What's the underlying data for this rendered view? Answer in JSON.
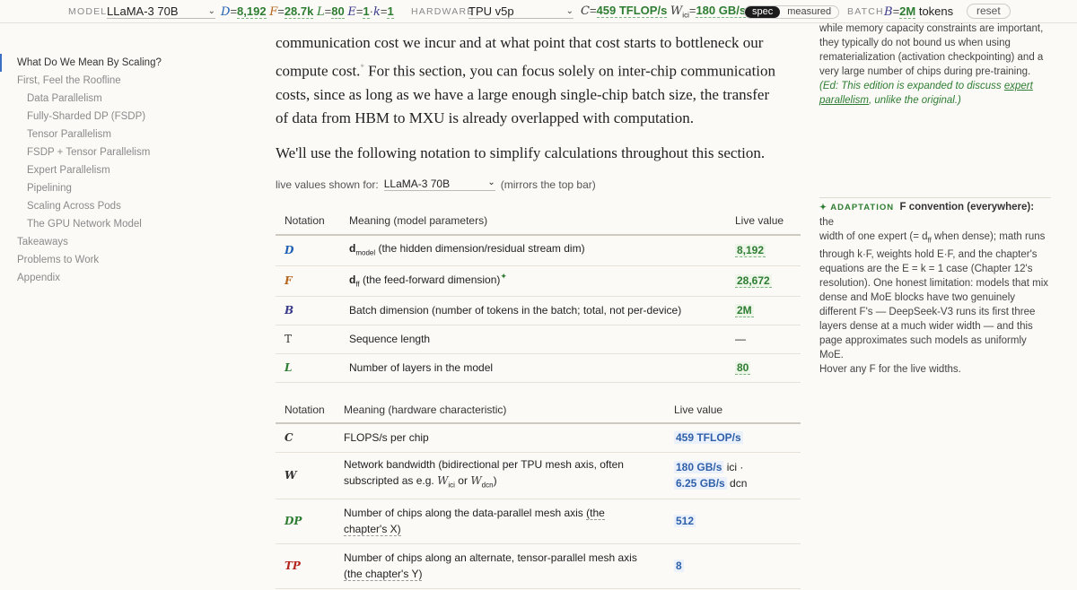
{
  "topbar": {
    "model_label": "MODEL",
    "model_value": "LLaMA-3 70B",
    "params": [
      {
        "sym": "D",
        "val": "8,192"
      },
      {
        "sym": "F",
        "val": "28.7k"
      },
      {
        "sym": "L",
        "val": "80"
      },
      {
        "sym": "E",
        "val": "1"
      },
      {
        "sym": "k",
        "val": "1"
      }
    ],
    "hardware_label": "HARDWARE",
    "hardware_value": "TPU v5p",
    "hw_c_sym": "C",
    "hw_c_val": "459 TFLOP/s",
    "hw_w_sym": "W",
    "hw_w_sub": "ici",
    "hw_w_val": "180 GB/s",
    "toggle_spec": "spec",
    "toggle_measured": "measured",
    "batch_label": "BATCH",
    "batch_sym": "B",
    "batch_val": "2M",
    "batch_unit": "tokens",
    "reset_label": "reset"
  },
  "sidebar": {
    "items": [
      {
        "label": "What Do We Mean By Scaling?",
        "level": 1,
        "active": true
      },
      {
        "label": "First, Feel the Roofline",
        "level": 1
      },
      {
        "label": "Data Parallelism",
        "level": 2
      },
      {
        "label": "Fully-Sharded DP (FSDP)",
        "level": 2
      },
      {
        "label": "Tensor Parallelism",
        "level": 2
      },
      {
        "label": "FSDP + Tensor Parallelism",
        "level": 2
      },
      {
        "label": "Expert Parallelism",
        "level": 2
      },
      {
        "label": "Pipelining",
        "level": 2
      },
      {
        "label": "Scaling Across Pods",
        "level": 2
      },
      {
        "label": "The GPU Network Model",
        "level": 2
      },
      {
        "label": "Takeaways",
        "level": 1
      },
      {
        "label": "Problems to Work",
        "level": 1
      },
      {
        "label": "Appendix",
        "level": 1
      }
    ]
  },
  "prose": {
    "p1_line1": "communication cost we incur and at what point that cost starts to bottleneck our",
    "p1_line2a": "compute cost.",
    "p1_fn": "*",
    "p1_line2b": " For this section, you can focus solely on inter-chip communication",
    "p1_line3": "costs, since as long as we have a large enough single-chip batch size, the transfer",
    "p1_line4": "of data from HBM to MXU is already overlapped with computation.",
    "p2": "We'll use the following notation to simplify calculations throughout this section."
  },
  "live_values": {
    "label": "live values shown for:",
    "selected": "LLaMA-3 70B",
    "note": "(mirrors the top bar)"
  },
  "model_table": {
    "headers": [
      "Notation",
      "Meaning (model parameters)",
      "Live value"
    ],
    "rows": [
      {
        "sym": "D",
        "meaning_main": "d",
        "meaning_sub": "model",
        "meaning_rest": " (the hidden dimension/residual stream dim)",
        "value": "8,192"
      },
      {
        "sym": "F",
        "meaning_main": "d",
        "meaning_sub": "ff",
        "meaning_rest": " (the feed-forward dimension)",
        "mark": "✦",
        "value": "28,672"
      },
      {
        "sym": "B",
        "meaning_rest": "Batch dimension (number of tokens in the batch; total, not per-device)",
        "value": "2M"
      },
      {
        "sym": "T",
        "meaning_rest": "Sequence length",
        "value": "—"
      },
      {
        "sym": "L",
        "meaning_rest": "Number of layers in the model",
        "value": "80"
      }
    ]
  },
  "hw_table": {
    "headers": [
      "Notation",
      "Meaning (hardware characteristic)",
      "Live value"
    ],
    "rows": [
      {
        "sym": "C",
        "meaning": "FLOPS/s per chip",
        "value": "459 TFLOP/s"
      },
      {
        "sym": "W",
        "meaning_a": "Network bandwidth (bidirectional per TPU mesh axis, often",
        "meaning_b": "subscripted as e.g. ",
        "w1": "W",
        "w1sub": "ici",
        "or": " or ",
        "w2": "W",
        "w2sub": "dcn",
        "close": ")",
        "value1": "180 GB/s",
        "value1_suffix": " ici ·",
        "value2": "6.25 GB/s",
        "value2_suffix": " dcn"
      },
      {
        "sym": "DP",
        "meaning_a": "Number of chips along the data-parallel mesh axis ",
        "meaning_u1": "(the",
        "meaning_u2": "chapter's X)",
        "value": "512"
      },
      {
        "sym": "TP",
        "meaning_a": "Number of chips along an alternate, tensor-parallel mesh axis",
        "meaning_u2": "(the chapter's Y)",
        "value": "8"
      }
    ]
  },
  "side_notes": {
    "n1_lines": [
      "while memory capacity constraints are important,",
      "they typically do not bound us when using",
      "rematerialization (activation checkpointing) and a",
      "very large number of chips during pre-training."
    ],
    "ed_a": "(Ed: This edition is expanded to discuss ",
    "ed_link1": "expert",
    "ed_link2": "parallelism",
    "ed_b": ", unlike the original.)",
    "adapt_tag": "✦ ADAPTATION",
    "adapt_title": "F convention (everywhere):",
    "adapt_lines": [
      " the",
      "width of one expert (= d",
      " when dense); math runs",
      "through k·F, weights hold E·F, and the chapter's",
      "equations are the E = k = 1 case (Chapter 12's",
      "resolution). One honest limitation: models that mix",
      "dense and MoE blocks have two genuinely",
      "different F's — DeepSeek-V3 runs its first three",
      "layers dense at a much wider width — and this",
      "page approximates such models as uniformly MoE.",
      "Hover any F for the live widths."
    ]
  }
}
